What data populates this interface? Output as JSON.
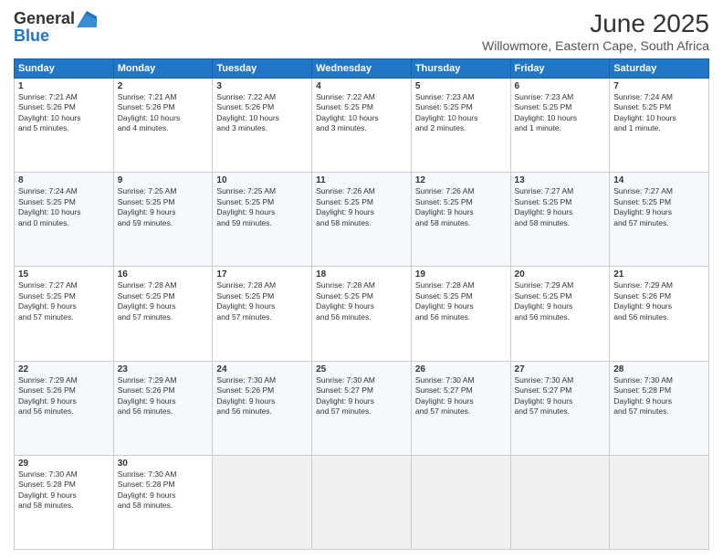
{
  "header": {
    "logo_general": "General",
    "logo_blue": "Blue",
    "month_title": "June 2025",
    "location": "Willowmore, Eastern Cape, South Africa"
  },
  "weekdays": [
    "Sunday",
    "Monday",
    "Tuesday",
    "Wednesday",
    "Thursday",
    "Friday",
    "Saturday"
  ],
  "weeks": [
    [
      {
        "day": "1",
        "info": "Sunrise: 7:21 AM\nSunset: 5:26 PM\nDaylight: 10 hours\nand 5 minutes."
      },
      {
        "day": "2",
        "info": "Sunrise: 7:21 AM\nSunset: 5:26 PM\nDaylight: 10 hours\nand 4 minutes."
      },
      {
        "day": "3",
        "info": "Sunrise: 7:22 AM\nSunset: 5:26 PM\nDaylight: 10 hours\nand 3 minutes."
      },
      {
        "day": "4",
        "info": "Sunrise: 7:22 AM\nSunset: 5:25 PM\nDaylight: 10 hours\nand 3 minutes."
      },
      {
        "day": "5",
        "info": "Sunrise: 7:23 AM\nSunset: 5:25 PM\nDaylight: 10 hours\nand 2 minutes."
      },
      {
        "day": "6",
        "info": "Sunrise: 7:23 AM\nSunset: 5:25 PM\nDaylight: 10 hours\nand 1 minute."
      },
      {
        "day": "7",
        "info": "Sunrise: 7:24 AM\nSunset: 5:25 PM\nDaylight: 10 hours\nand 1 minute."
      }
    ],
    [
      {
        "day": "8",
        "info": "Sunrise: 7:24 AM\nSunset: 5:25 PM\nDaylight: 10 hours\nand 0 minutes."
      },
      {
        "day": "9",
        "info": "Sunrise: 7:25 AM\nSunset: 5:25 PM\nDaylight: 9 hours\nand 59 minutes."
      },
      {
        "day": "10",
        "info": "Sunrise: 7:25 AM\nSunset: 5:25 PM\nDaylight: 9 hours\nand 59 minutes."
      },
      {
        "day": "11",
        "info": "Sunrise: 7:26 AM\nSunset: 5:25 PM\nDaylight: 9 hours\nand 58 minutes."
      },
      {
        "day": "12",
        "info": "Sunrise: 7:26 AM\nSunset: 5:25 PM\nDaylight: 9 hours\nand 58 minutes."
      },
      {
        "day": "13",
        "info": "Sunrise: 7:27 AM\nSunset: 5:25 PM\nDaylight: 9 hours\nand 58 minutes."
      },
      {
        "day": "14",
        "info": "Sunrise: 7:27 AM\nSunset: 5:25 PM\nDaylight: 9 hours\nand 57 minutes."
      }
    ],
    [
      {
        "day": "15",
        "info": "Sunrise: 7:27 AM\nSunset: 5:25 PM\nDaylight: 9 hours\nand 57 minutes."
      },
      {
        "day": "16",
        "info": "Sunrise: 7:28 AM\nSunset: 5:25 PM\nDaylight: 9 hours\nand 57 minutes."
      },
      {
        "day": "17",
        "info": "Sunrise: 7:28 AM\nSunset: 5:25 PM\nDaylight: 9 hours\nand 57 minutes."
      },
      {
        "day": "18",
        "info": "Sunrise: 7:28 AM\nSunset: 5:25 PM\nDaylight: 9 hours\nand 56 minutes."
      },
      {
        "day": "19",
        "info": "Sunrise: 7:28 AM\nSunset: 5:25 PM\nDaylight: 9 hours\nand 56 minutes."
      },
      {
        "day": "20",
        "info": "Sunrise: 7:29 AM\nSunset: 5:25 PM\nDaylight: 9 hours\nand 56 minutes."
      },
      {
        "day": "21",
        "info": "Sunrise: 7:29 AM\nSunset: 5:26 PM\nDaylight: 9 hours\nand 56 minutes."
      }
    ],
    [
      {
        "day": "22",
        "info": "Sunrise: 7:29 AM\nSunset: 5:26 PM\nDaylight: 9 hours\nand 56 minutes."
      },
      {
        "day": "23",
        "info": "Sunrise: 7:29 AM\nSunset: 5:26 PM\nDaylight: 9 hours\nand 56 minutes."
      },
      {
        "day": "24",
        "info": "Sunrise: 7:30 AM\nSunset: 5:26 PM\nDaylight: 9 hours\nand 56 minutes."
      },
      {
        "day": "25",
        "info": "Sunrise: 7:30 AM\nSunset: 5:27 PM\nDaylight: 9 hours\nand 57 minutes."
      },
      {
        "day": "26",
        "info": "Sunrise: 7:30 AM\nSunset: 5:27 PM\nDaylight: 9 hours\nand 57 minutes."
      },
      {
        "day": "27",
        "info": "Sunrise: 7:30 AM\nSunset: 5:27 PM\nDaylight: 9 hours\nand 57 minutes."
      },
      {
        "day": "28",
        "info": "Sunrise: 7:30 AM\nSunset: 5:28 PM\nDaylight: 9 hours\nand 57 minutes."
      }
    ],
    [
      {
        "day": "29",
        "info": "Sunrise: 7:30 AM\nSunset: 5:28 PM\nDaylight: 9 hours\nand 58 minutes."
      },
      {
        "day": "30",
        "info": "Sunrise: 7:30 AM\nSunset: 5:28 PM\nDaylight: 9 hours\nand 58 minutes."
      },
      {
        "day": "",
        "info": ""
      },
      {
        "day": "",
        "info": ""
      },
      {
        "day": "",
        "info": ""
      },
      {
        "day": "",
        "info": ""
      },
      {
        "day": "",
        "info": ""
      }
    ]
  ]
}
